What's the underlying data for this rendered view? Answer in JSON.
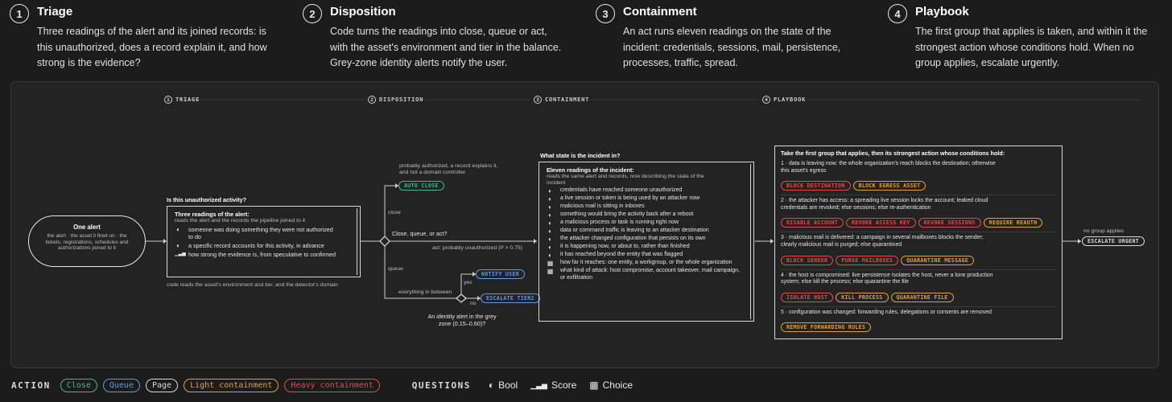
{
  "steps": [
    {
      "num": "1",
      "title": "Triage",
      "desc": "Three readings of the alert and its joined records: is this unauthorized, does a record explain it, and how strong is the evidence?"
    },
    {
      "num": "2",
      "title": "Disposition",
      "desc": "Code turns the readings into close, queue or act, with the asset's environment and tier in the balance. Grey-zone identity alerts notify the user."
    },
    {
      "num": "3",
      "title": "Containment",
      "desc": "An act runs eleven readings on the state of the incident: credentials, sessions, mail, persistence, processes, traffic, spread."
    },
    {
      "num": "4",
      "title": "Playbook",
      "desc": "The first group that applies is taken, and within it the strongest action whose conditions hold. When no group applies, escalate urgently."
    }
  ],
  "sections": [
    {
      "num": "1",
      "label": "TRIAGE"
    },
    {
      "num": "2",
      "label": "DISPOSITION"
    },
    {
      "num": "3",
      "label": "CONTAINMENT"
    },
    {
      "num": "4",
      "label": "PLAYBOOK"
    }
  ],
  "alert": {
    "title": "One alert",
    "desc": "the alert · the asset it fired on · the tickets, registrations, schedules and authorizations joined to it"
  },
  "triage": {
    "question": "Is this unauthorized activity?",
    "title": "Three readings of the alert:",
    "sub": "reads the alert and the records the pipeline joined to it",
    "items": [
      {
        "icon": "◐",
        "text": "someone was doing something they were not authorized to do"
      },
      {
        "icon": "◐",
        "text": "a specific record accounts for this activity, in advance"
      },
      {
        "icon": "▁▃▅",
        "text": "how strong the evidence is, from speculative to confirmed"
      }
    ],
    "footnote": "code reads the asset's environment and tier, and the detector's domain"
  },
  "disposition": {
    "decision": "Close, queue, or act?",
    "close_note": "probably authorized, a record explains it, and not a domain controller",
    "close_label": "close",
    "auto_close": "AUTO CLOSE",
    "act_label": "act: probably unauthorized (P > 0.75)",
    "queue_label": "queue",
    "between_label": "everything in between",
    "yes": "yes",
    "no": "no",
    "notify_user": "NOTIFY USER",
    "escalate_tier2": "ESCALATE TIER2",
    "grey_question": "An identity alert in the grey zone (0.15–0.60)?"
  },
  "containment": {
    "question": "What state is the incident in?",
    "title": "Eleven readings of the incident:",
    "sub": "reads the same alert and records, now describing the state of the incident",
    "items": [
      {
        "icon": "◐",
        "text": "credentials have reached someone unauthorized"
      },
      {
        "icon": "◐",
        "text": "a live session or token is being used by an attacker now"
      },
      {
        "icon": "◐",
        "text": "malicious mail is sitting in inboxes"
      },
      {
        "icon": "◐",
        "text": "something would bring the activity back after a reboot"
      },
      {
        "icon": "◐",
        "text": "a malicious process or task is running right now"
      },
      {
        "icon": "◐",
        "text": "data or command traffic is leaving to an attacker destination"
      },
      {
        "icon": "◐",
        "text": "the attacker changed configuration that persists on its own"
      },
      {
        "icon": "◐",
        "text": "it is happening now, or about to, rather than finished"
      },
      {
        "icon": "◐",
        "text": "it has reached beyond the entity that was flagged"
      },
      {
        "icon": "▦",
        "text": "how far it reaches: one entity, a workgroup, or the whole organization"
      },
      {
        "icon": "▦",
        "text": "what kind of attack: host compromise, account takeover, mail campaign, or exfiltration"
      }
    ]
  },
  "playbook": {
    "title": "Take the first group that applies, then its strongest action whose conditions hold:",
    "groups": [
      {
        "text": "1 · data is leaving now: the whole organization's reach blocks the destination; otherwise this asset's egress",
        "tags": [
          {
            "label": "BLOCK DESTINATION",
            "kind": "heavy"
          },
          {
            "label": "BLOCK EGRESS ASSET",
            "kind": "light"
          }
        ]
      },
      {
        "text": "2 · the attacker has access: a spreading live session locks the account; leaked cloud credentials are revoked; else sessions; else re-authentication",
        "tags": [
          {
            "label": "DISABLE ACCOUNT",
            "kind": "heavy"
          },
          {
            "label": "REVOKE ACCESS KEY",
            "kind": "heavy"
          },
          {
            "label": "REVOKE SESSIONS",
            "kind": "heavy"
          },
          {
            "label": "REQUIRE REAUTH",
            "kind": "light"
          }
        ]
      },
      {
        "text": "3 · malicious mail is delivered: a campaign in several mailboxes blocks the sender; clearly malicious mail is purged; else quarantined",
        "tags": [
          {
            "label": "BLOCK SENDER",
            "kind": "heavy"
          },
          {
            "label": "PURGE MAILBOXES",
            "kind": "heavy"
          },
          {
            "label": "QUARANTINE MESSAGE",
            "kind": "light"
          }
        ]
      },
      {
        "text": "4 · the host is compromised: live persistence isolates the host, never a lone production system; else kill the process; else quarantine the file",
        "tags": [
          {
            "label": "ISOLATE HOST",
            "kind": "heavy"
          },
          {
            "label": "KILL PROCESS",
            "kind": "light"
          },
          {
            "label": "QUARANTINE FILE",
            "kind": "light"
          }
        ]
      },
      {
        "text": "5 · configuration was changed: forwarding rules, delegations or consents are removed",
        "tags": [
          {
            "label": "REMOVE FORWARDING RULES",
            "kind": "light"
          }
        ]
      }
    ],
    "no_group": "no group applies",
    "escalate_urgent": "ESCALATE URGENT"
  },
  "legend": {
    "action_heading": "ACTION",
    "actions": [
      {
        "label": "Close",
        "kind": "close"
      },
      {
        "label": "Queue",
        "kind": "queue"
      },
      {
        "label": "Page",
        "kind": "page"
      },
      {
        "label": "Light containment",
        "kind": "light"
      },
      {
        "label": "Heavy containment",
        "kind": "heavy"
      }
    ],
    "questions_heading": "QUESTIONS",
    "questions": [
      {
        "icon": "◐",
        "label": "Bool"
      },
      {
        "icon": "▁▃▅",
        "label": "Score"
      },
      {
        "icon": "▦",
        "label": "Choice"
      }
    ]
  },
  "colors": {
    "close": "#3fb98a",
    "queue": "#5a9ae6",
    "page": "#d8d8d8",
    "light": "#e0a13a",
    "heavy": "#e24a4a"
  }
}
